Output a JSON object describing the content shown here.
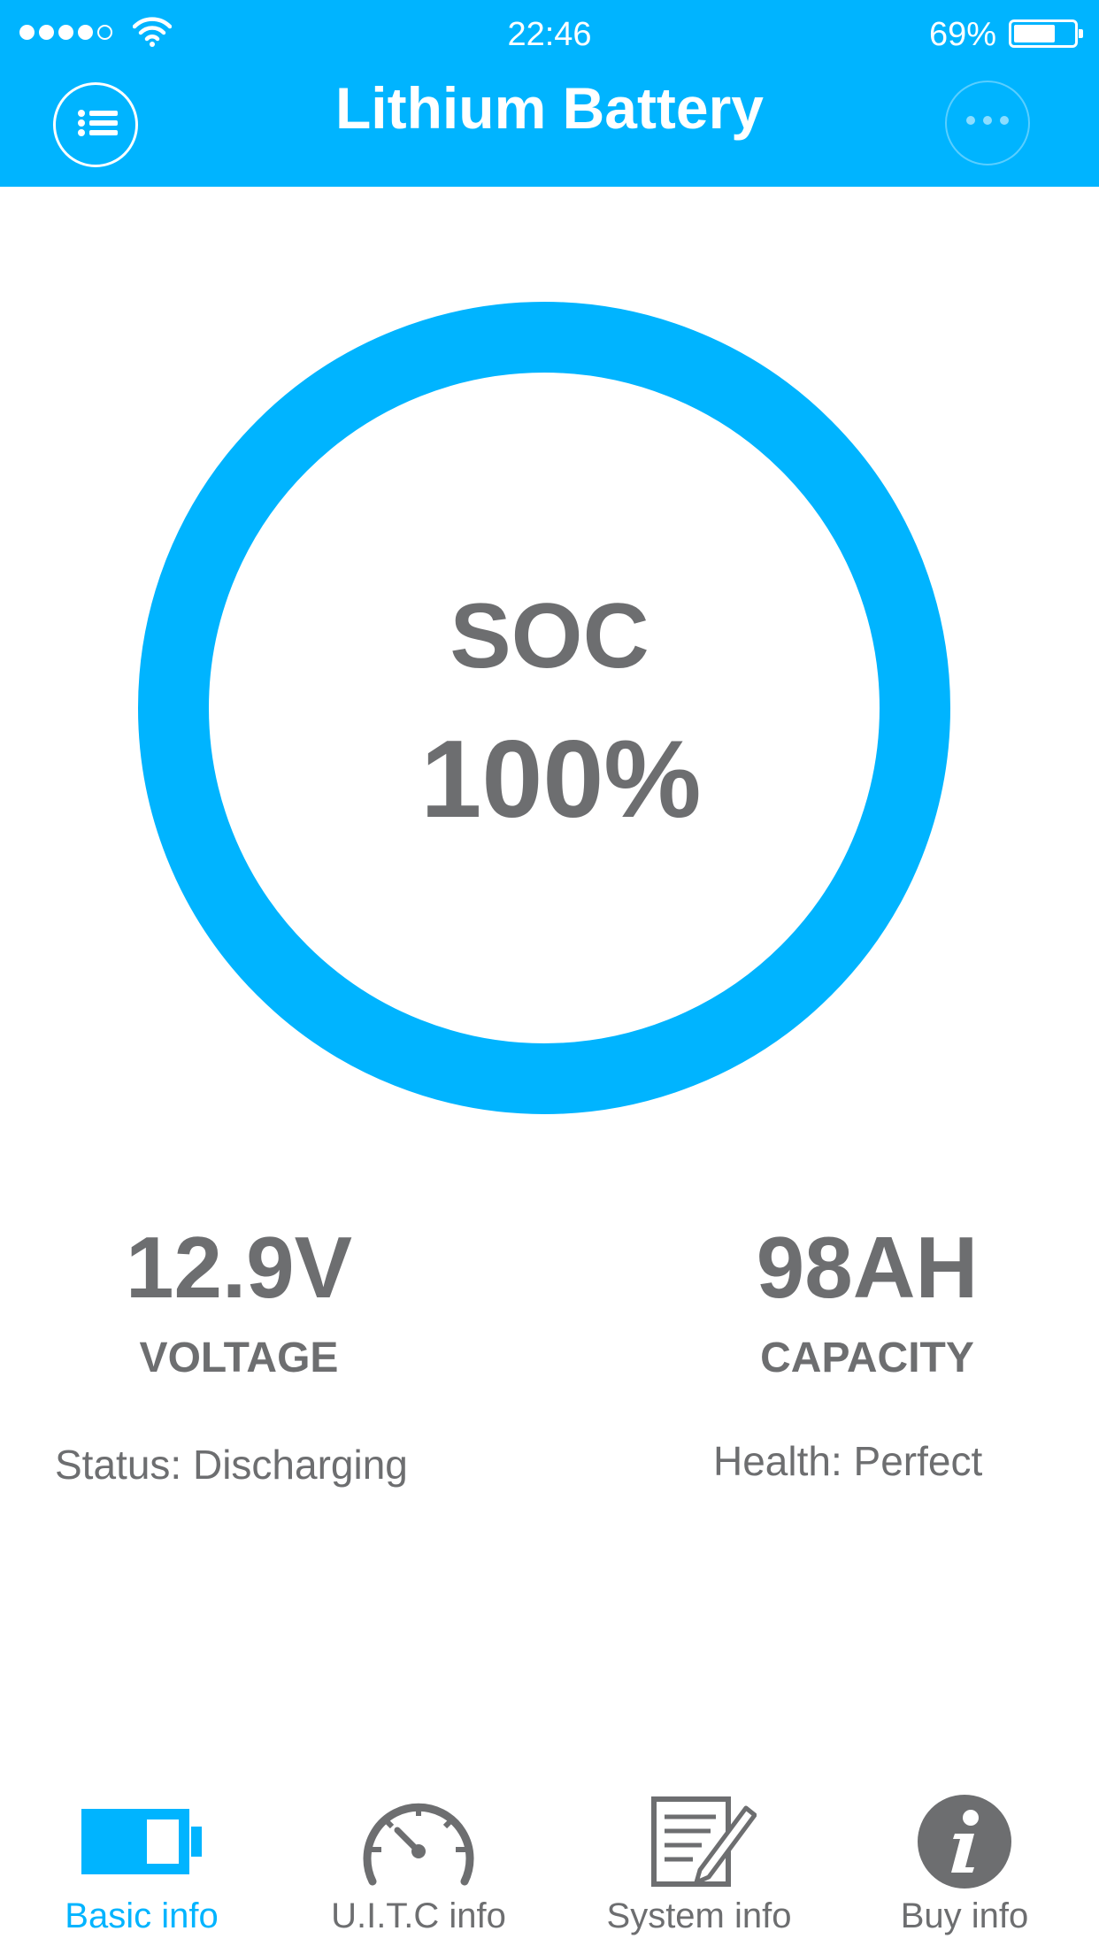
{
  "status_bar": {
    "time": "22:46",
    "battery_percent": "69%",
    "battery_level": 0.69,
    "signal_bars": 4,
    "signal_max": 5
  },
  "header": {
    "title": "Lithium Battery",
    "menu_icon": "list-icon",
    "more_icon": "more-dots-icon"
  },
  "gauge": {
    "label": "SOC",
    "value": "100%",
    "fraction": 1.0,
    "color": "#00b4ff"
  },
  "stats": {
    "voltage": {
      "value": "12.9V",
      "label": "VOLTAGE"
    },
    "capacity": {
      "value": "98AH",
      "label": "CAPACITY"
    }
  },
  "info": {
    "status": "Status: Discharging",
    "health": "Health: Perfect"
  },
  "tabs": [
    {
      "label": "Basic info",
      "icon": "battery-icon",
      "active": true
    },
    {
      "label": "U.I.T.C info",
      "icon": "speedometer-icon",
      "active": false
    },
    {
      "label": "System info",
      "icon": "document-edit-icon",
      "active": false
    },
    {
      "label": "Buy info",
      "icon": "info-icon",
      "active": false
    }
  ],
  "colors": {
    "accent": "#00b4ff",
    "text": "#6d6e70",
    "inactive_icon": "#6d6e70"
  }
}
